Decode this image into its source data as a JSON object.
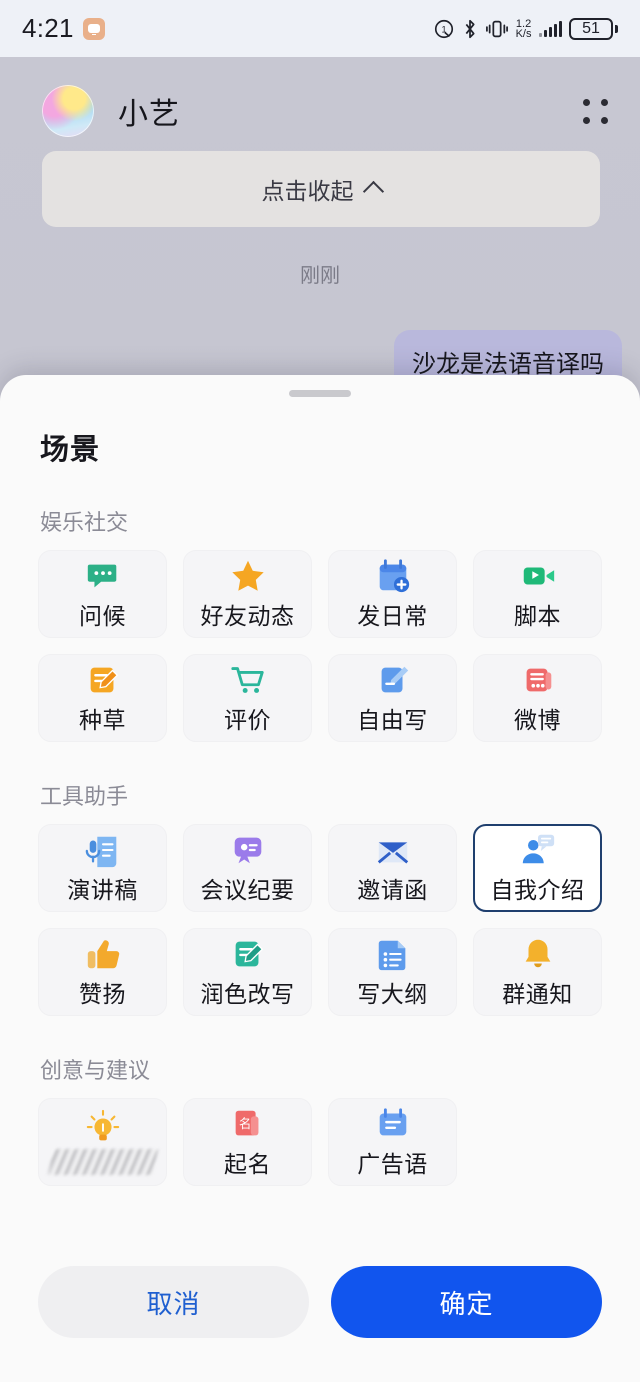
{
  "status_bar": {
    "time": "4:21",
    "sms_icon": "message-badge-icon",
    "alarm_icon": "alarm-icon",
    "bluetooth_icon": "bluetooth-icon",
    "vibrate_icon": "vibrate-icon",
    "net_speed_value": "1.2",
    "net_speed_unit": "K/s",
    "signal_icon": "cellular-signal-icon",
    "battery_level": "51"
  },
  "chat": {
    "title": "小艺",
    "avatar": "assistant-avatar",
    "menu_icon": "four-dot-menu-icon",
    "collapse_label": "点击收起",
    "collapse_chevron": "chevron-up-icon",
    "timestamp": "刚刚",
    "user_message": "沙龙是法语音译吗"
  },
  "sheet": {
    "handle": "drag-handle",
    "title": "场景",
    "sections": [
      {
        "label": "娱乐社交",
        "cards": [
          {
            "label": "问候",
            "icon": "chat-bubble-icon",
            "selected": false,
            "blurred": false
          },
          {
            "label": "好友动态",
            "icon": "star-icon",
            "selected": false,
            "blurred": false
          },
          {
            "label": "发日常",
            "icon": "calendar-add-icon",
            "selected": false,
            "blurred": false
          },
          {
            "label": "脚本",
            "icon": "video-camera-icon",
            "selected": false,
            "blurred": false
          },
          {
            "label": "种草",
            "icon": "note-pencil-icon",
            "selected": false,
            "blurred": false
          },
          {
            "label": "评价",
            "icon": "shopping-cart-icon",
            "selected": false,
            "blurred": false
          },
          {
            "label": "自由写",
            "icon": "pen-document-icon",
            "selected": false,
            "blurred": false
          },
          {
            "label": "微博",
            "icon": "weibo-card-icon",
            "selected": false,
            "blurred": false
          }
        ]
      },
      {
        "label": "工具助手",
        "cards": [
          {
            "label": "演讲稿",
            "icon": "microphone-scroll-icon",
            "selected": false,
            "blurred": false
          },
          {
            "label": "会议纪要",
            "icon": "meeting-badge-icon",
            "selected": false,
            "blurred": false
          },
          {
            "label": "邀请函",
            "icon": "envelope-icon",
            "selected": false,
            "blurred": false
          },
          {
            "label": "自我介绍",
            "icon": "person-speech-icon",
            "selected": true,
            "blurred": false
          },
          {
            "label": "赞扬",
            "icon": "thumbs-up-icon",
            "selected": false,
            "blurred": false
          },
          {
            "label": "润色改写",
            "icon": "note-pencil-green-icon",
            "selected": false,
            "blurred": false
          },
          {
            "label": "写大纲",
            "icon": "document-list-icon",
            "selected": false,
            "blurred": false
          },
          {
            "label": "群通知",
            "icon": "bell-icon",
            "selected": false,
            "blurred": false
          }
        ]
      },
      {
        "label": "创意与建议",
        "cards": [
          {
            "label": "",
            "icon": "lightbulb-icon",
            "selected": false,
            "blurred": true
          },
          {
            "label": "起名",
            "icon": "red-name-card-icon",
            "selected": false,
            "blurred": false
          },
          {
            "label": "广告语",
            "icon": "blue-banner-icon",
            "selected": false,
            "blurred": false
          }
        ]
      }
    ],
    "cancel_label": "取消",
    "confirm_label": "确定"
  },
  "colors": {
    "accent_blue": "#1155ee",
    "cancel_text": "#1f5fd0",
    "selected_border": "#1f3f6e",
    "background": "#c3c3ce"
  }
}
